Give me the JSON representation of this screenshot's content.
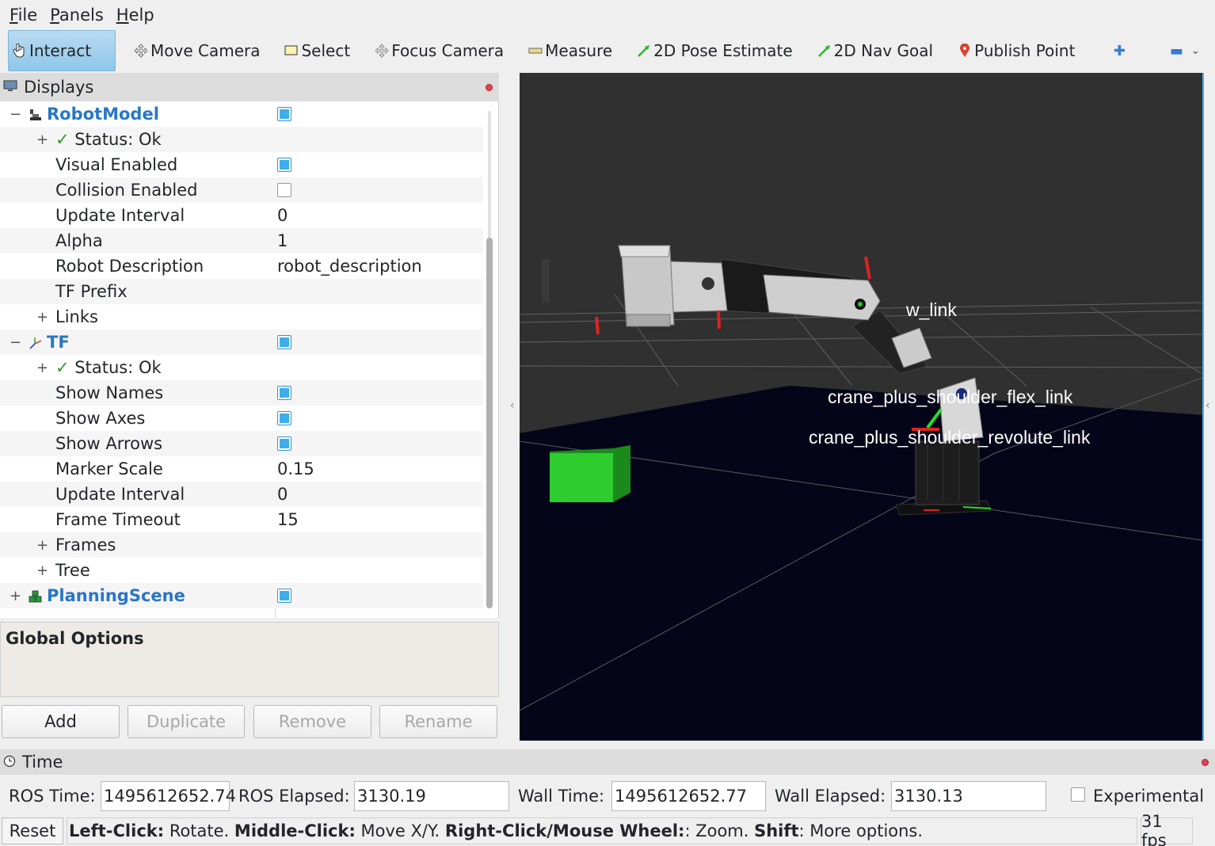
{
  "menu": [
    {
      "label_u": "F",
      "label_rest": "ile"
    },
    {
      "label_u": "P",
      "label_rest": "anels"
    },
    {
      "label_u": "H",
      "label_rest": "elp"
    }
  ],
  "toolbar": {
    "interact": "Interact",
    "move_camera": "Move Camera",
    "select": "Select",
    "focus_camera": "Focus Camera",
    "measure": "Measure",
    "pose_estimate": "2D Pose Estimate",
    "nav_goal": "2D Nav Goal",
    "publish_point": "Publish Point"
  },
  "displays": {
    "title": "Displays",
    "rows": {
      "robot_model": "RobotModel",
      "status_ok": "Status: Ok",
      "visual_enabled": "Visual Enabled",
      "collision_enabled": "Collision Enabled",
      "update_interval": "Update Interval",
      "update_interval_val": "0",
      "alpha": "Alpha",
      "alpha_val": "1",
      "robot_description": "Robot Description",
      "robot_description_val": "robot_description",
      "tf_prefix": "TF Prefix",
      "links": "Links",
      "tf": "TF",
      "tf_status_ok": "Status: Ok",
      "show_names": "Show Names",
      "show_axes": "Show Axes",
      "show_arrows": "Show Arrows",
      "marker_scale": "Marker Scale",
      "marker_scale_val": "0.15",
      "tf_update_interval": "Update Interval",
      "tf_update_interval_val": "0",
      "frame_timeout": "Frame Timeout",
      "frame_timeout_val": "15",
      "frames": "Frames",
      "tree": "Tree",
      "planning_scene": "PlanningScene"
    },
    "global_options": "Global Options",
    "buttons": {
      "add": "Add",
      "duplicate": "Duplicate",
      "remove": "Remove",
      "rename": "Rename"
    }
  },
  "viewport": {
    "labels": {
      "elbow": "w_link",
      "shoulder_flex": "crane_plus_shoulder_flex_link",
      "shoulder_revolute": "crane_plus_shoulder_revolute_link"
    }
  },
  "time": {
    "title": "Time",
    "ros_time_label": "ROS Time:",
    "ros_time": "1495612652.74",
    "ros_elapsed_label": "ROS Elapsed:",
    "ros_elapsed": "3130.19",
    "wall_time_label": "Wall Time:",
    "wall_time": "1495612652.77",
    "wall_elapsed_label": "Wall Elapsed:",
    "wall_elapsed": "3130.13",
    "experimental": "Experimental"
  },
  "status": {
    "reset": "Reset",
    "hint_left_key": "Left-Click:",
    "hint_left": " Rotate. ",
    "hint_middle_key": "Middle-Click:",
    "hint_middle": " Move X/Y. ",
    "hint_right_key": "Right-Click/Mouse Wheel:",
    "hint_right": ": Zoom. ",
    "hint_shift_key": "Shift",
    "hint_shift": ": More options.",
    "fps": "31 fps"
  }
}
